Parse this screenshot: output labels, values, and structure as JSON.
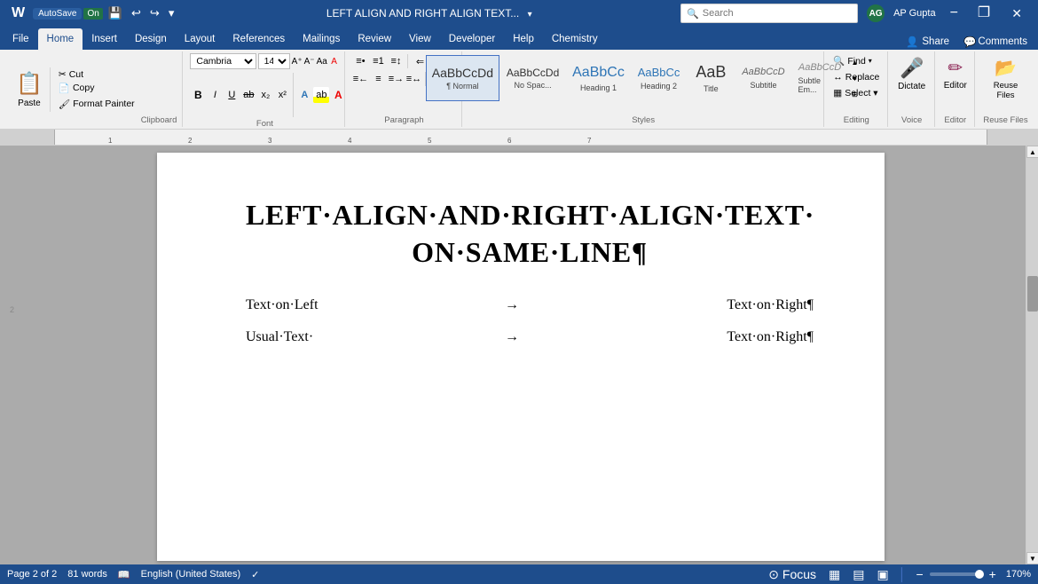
{
  "titleBar": {
    "autosave_label": "AutoSave",
    "autosave_state": "On",
    "title": "LEFT ALIGN AND RIGHT ALIGN TEXT...",
    "search_placeholder": "Search",
    "user_initials": "AG",
    "user_name": "AP Gupta",
    "window_controls": {
      "minimize": "−",
      "restore": "❐",
      "close": "✕"
    }
  },
  "ribbonTabs": {
    "tabs": [
      {
        "label": "File",
        "id": "file"
      },
      {
        "label": "Home",
        "id": "home",
        "active": true
      },
      {
        "label": "Insert",
        "id": "insert"
      },
      {
        "label": "Design",
        "id": "design"
      },
      {
        "label": "Layout",
        "id": "layout"
      },
      {
        "label": "References",
        "id": "references"
      },
      {
        "label": "Mailings",
        "id": "mailings"
      },
      {
        "label": "Review",
        "id": "review"
      },
      {
        "label": "View",
        "id": "view"
      },
      {
        "label": "Developer",
        "id": "developer"
      },
      {
        "label": "Help",
        "id": "help"
      },
      {
        "label": "Chemistry",
        "id": "chemistry"
      }
    ],
    "share_label": "Share",
    "comments_label": "Comments"
  },
  "ribbon": {
    "clipboard": {
      "paste_label": "Paste",
      "cut_label": "Cut",
      "copy_label": "Copy",
      "format_painter_label": "Format Painter"
    },
    "font": {
      "font_name": "Cambria",
      "font_size": "14",
      "bold": "B",
      "italic": "I",
      "underline": "U",
      "strikethrough": "ab",
      "subscript": "x₂",
      "superscript": "x²",
      "grow": "A",
      "shrink": "A",
      "change_case": "Aa",
      "clear_format": "A",
      "font_color": "A",
      "highlight": "ab",
      "group_label": "Font"
    },
    "paragraph": {
      "bullets": "≡",
      "numbering": "≡",
      "multilevel": "≡",
      "decrease_indent": "←",
      "increase_indent": "→",
      "sort": "↕",
      "pilcrow": "¶",
      "align_left": "≡",
      "align_center": "≡",
      "align_right": "≡",
      "justify": "≡",
      "line_spacing": "↕",
      "shading": "▌",
      "borders": "⊞",
      "group_label": "Paragraph"
    },
    "styles": {
      "items": [
        {
          "id": "normal",
          "preview": "AaBbCcDd",
          "label": "¶ Normal",
          "active": true
        },
        {
          "id": "no-space",
          "preview": "AaBbCcDd",
          "label": "No Spac...",
          "active": false
        },
        {
          "id": "heading1",
          "preview": "AaBbCc",
          "label": "Heading 1",
          "active": false
        },
        {
          "id": "heading2",
          "preview": "AaBbCc",
          "label": "Heading 2",
          "active": false
        },
        {
          "id": "title",
          "preview": "AaB",
          "label": "Title",
          "active": false
        },
        {
          "id": "subtitle",
          "preview": "AaBbCcD",
          "label": "Subtitle",
          "active": false
        },
        {
          "id": "subtle-em",
          "preview": "AaBbCcD",
          "label": "Subtle Em...",
          "active": false
        }
      ],
      "group_label": "Styles"
    },
    "editing": {
      "find_label": "Find",
      "replace_label": "Replace",
      "select_label": "Select ▾",
      "group_label": "Editing"
    },
    "voice": {
      "dictate_label": "Dictate",
      "group_label": "Voice"
    },
    "editor_group": {
      "editor_label": "Editor",
      "group_label": "Editor"
    },
    "reuse": {
      "reuse_label": "Reuse Files",
      "group_label": "Reuse Files"
    }
  },
  "document": {
    "title_line1": "LEFT·ALIGN·AND·RIGHT·ALIGN·TEXT·",
    "title_line2": "ON·SAME·LINE¶",
    "rows": [
      {
        "left": "Text·on·Left",
        "arrow": "→",
        "right": "Text·on·Right¶"
      },
      {
        "left": "Usual·Text·",
        "arrow": "→",
        "right": "Text·on·Right¶"
      }
    ]
  },
  "statusBar": {
    "page_info": "Page 2 of 2",
    "words_info": "81 words",
    "language": "English (United States)",
    "accessibility": "✓",
    "focus_label": "Focus",
    "view_icons": [
      "▦",
      "▤",
      "▣"
    ],
    "zoom_percent": "170%",
    "minus_label": "−",
    "plus_label": "+"
  }
}
